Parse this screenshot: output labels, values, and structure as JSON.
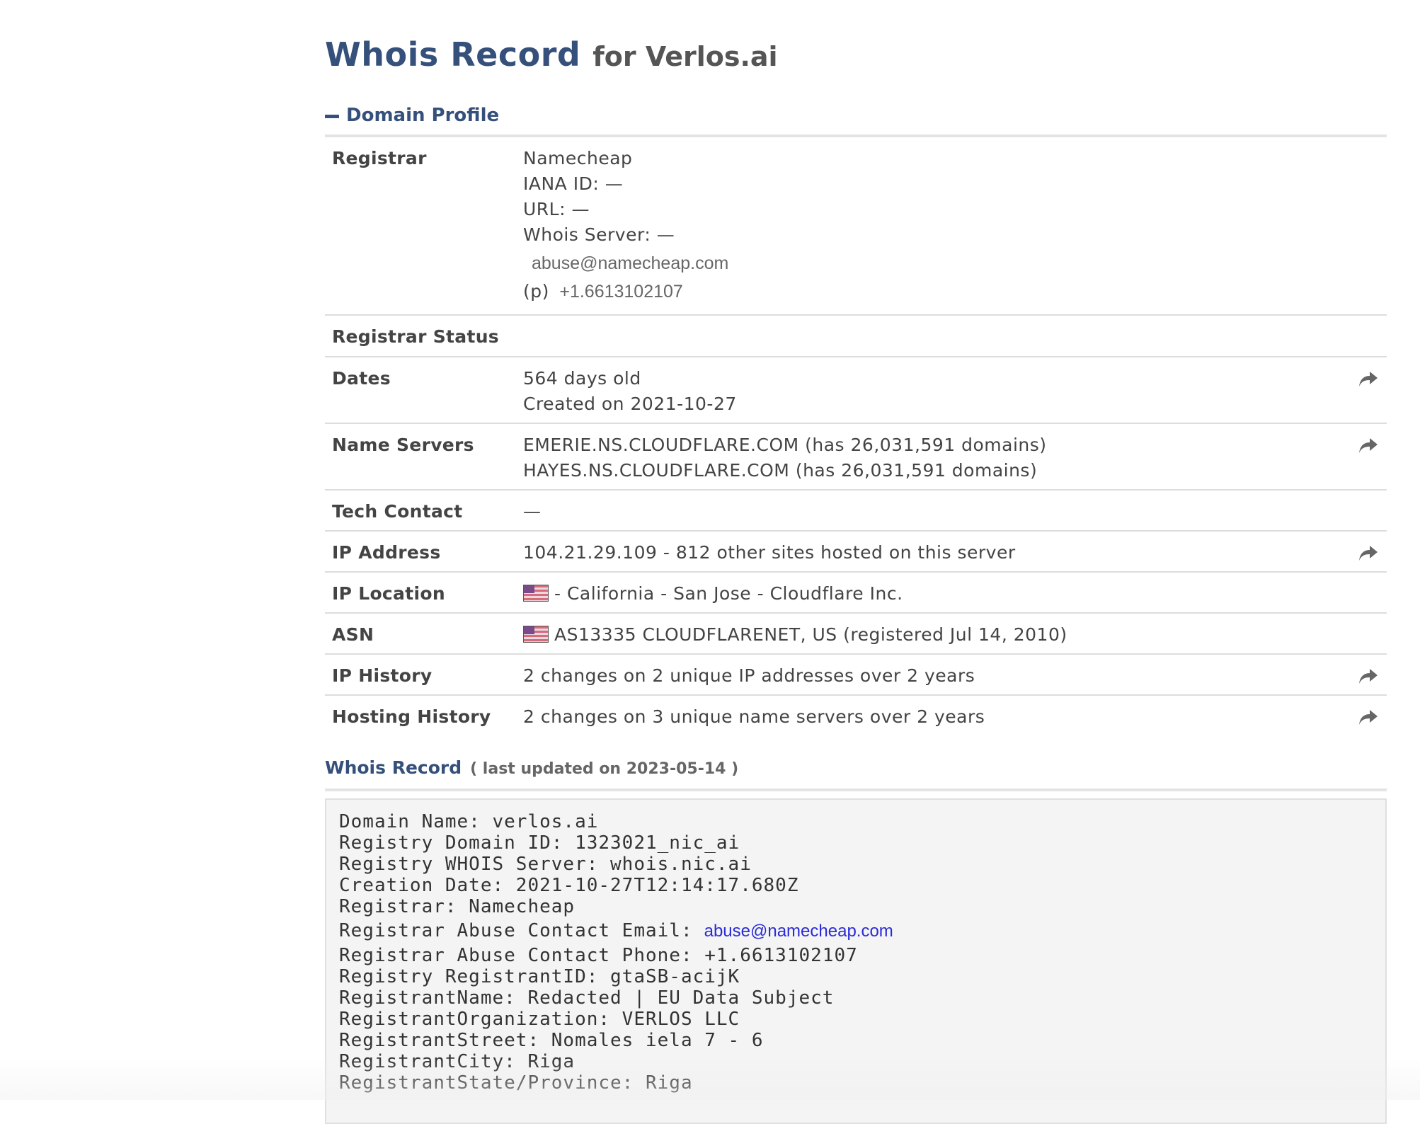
{
  "header": {
    "title": "Whois Record",
    "for_text": "for Verlos.ai"
  },
  "domain_profile": {
    "heading": "Domain Profile",
    "rows": {
      "registrar": {
        "label": "Registrar",
        "name": "Namecheap",
        "iana_id": "IANA ID: —",
        "url": "URL: —",
        "whois_server": "Whois Server: —",
        "email": "abuse@namecheap.com",
        "phone_prefix": "(p)",
        "phone": "+1.6613102107"
      },
      "registrar_status": {
        "label": "Registrar Status",
        "value": ""
      },
      "dates": {
        "label": "Dates",
        "age": "564 days old",
        "created": "Created on 2021-10-27"
      },
      "name_servers": {
        "label": "Name Servers",
        "ns1": "EMERIE.NS.CLOUDFLARE.COM (has 26,031,591 domains)",
        "ns2": "HAYES.NS.CLOUDFLARE.COM (has 26,031,591 domains)"
      },
      "tech_contact": {
        "label": "Tech Contact",
        "value": "—"
      },
      "ip_address": {
        "label": "IP Address",
        "value": "104.21.29.109 - 812 other sites hosted on this server"
      },
      "ip_location": {
        "label": "IP Location",
        "value": "- California - San Jose - Cloudflare Inc."
      },
      "asn": {
        "label": "ASN",
        "value": "AS13335 CLOUDFLARENET, US (registered Jul 14, 2010)"
      },
      "ip_history": {
        "label": "IP History",
        "value": "2 changes on 2 unique IP addresses over 2 years"
      },
      "hosting_history": {
        "label": "Hosting History",
        "value": "2 changes on 3 unique name servers over 2 years"
      }
    }
  },
  "whois_record": {
    "heading": "Whois Record",
    "updated": "( last updated on 2023-05-14 )",
    "lines": {
      "l1": "Domain Name: verlos.ai",
      "l2": "Registry Domain ID: 1323021_nic_ai",
      "l3": "Registry WHOIS Server: whois.nic.ai",
      "l4": "Creation Date: 2021-10-27T12:14:17.680Z",
      "l5": "Registrar: Namecheap",
      "l6_label": "Registrar Abuse Contact Email:",
      "l6_email": "abuse@namecheap.com",
      "l7": "Registrar Abuse Contact Phone: +1.6613102107",
      "l8": "Registry RegistrantID: gtaSB-acijK",
      "l9": "RegistrantName: Redacted | EU Data Subject",
      "l10": "RegistrantOrganization: VERLOS LLC",
      "l11": "RegistrantStreet: Nomales iela 7 - 6",
      "l12": "RegistrantCity: Riga",
      "l13": "RegistrantState/Province: Riga"
    }
  },
  "icons": {
    "share": "share-arrow-icon",
    "collapse": "minus-icon",
    "flag": "us-flag-icon"
  },
  "colors": {
    "heading_blue": "#35507a",
    "link_blue": "#2a2ad8",
    "text_gray": "#444444"
  }
}
